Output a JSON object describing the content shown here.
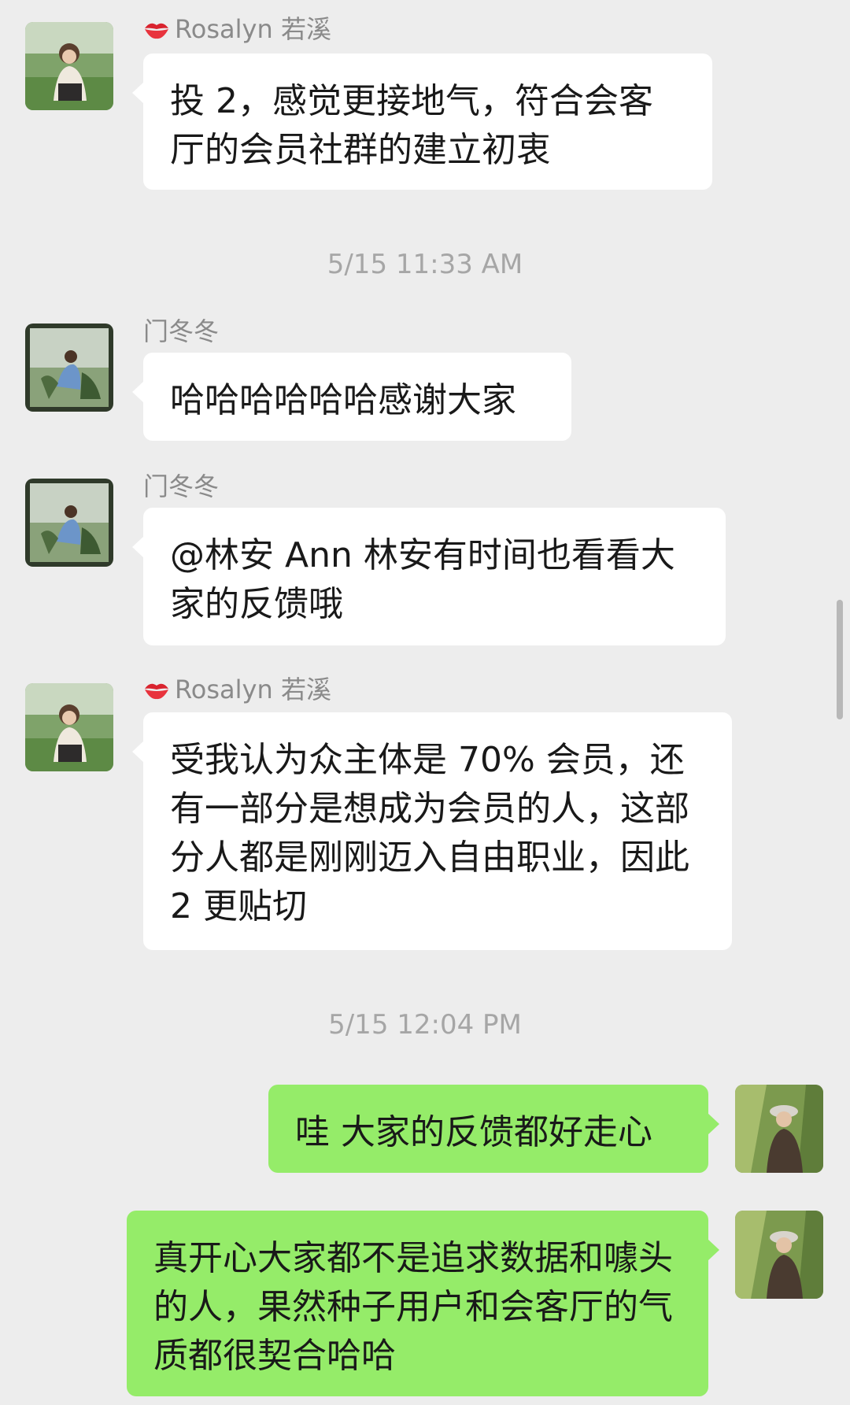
{
  "messages": [
    {
      "type": "left",
      "sender": "Rosalyn 若溪",
      "kiss": true,
      "text": "投 2，感觉更接地气，符合会客厅的会员社群的建立初衷",
      "avatar": "avatar-rosalyn"
    },
    {
      "type": "time",
      "text": "5/15 11:33 AM"
    },
    {
      "type": "left",
      "sender": "门冬冬",
      "kiss": false,
      "text": "哈哈哈哈哈哈感谢大家",
      "avatar": "avatar-mendongdong"
    },
    {
      "type": "left",
      "sender": "门冬冬",
      "kiss": false,
      "text": "@林安 Ann 林安有时间也看看大家的反馈哦",
      "avatar": "avatar-mendongdong"
    },
    {
      "type": "left",
      "sender": "Rosalyn 若溪",
      "kiss": true,
      "text": "受我认为众主体是 70% 会员，还有一部分是想成为会员的人，这部分人都是刚刚迈入自由职业，因此 2 更贴切",
      "avatar": "avatar-rosalyn"
    },
    {
      "type": "time",
      "text": "5/15 12:04 PM"
    },
    {
      "type": "right",
      "text": "哇 大家的反馈都好走心",
      "avatar": "avatar-me"
    },
    {
      "type": "right",
      "text": "真开心大家都不是追求数据和噱头的人，果然种子用户和会客厅的气质都很契合哈哈",
      "avatar": "avatar-me"
    }
  ],
  "colors": {
    "background": "#ededed",
    "bubble_left": "#ffffff",
    "bubble_right": "#95ec69",
    "sender_text": "#8a8a8a",
    "timestamp_text": "#a6a6a6"
  }
}
